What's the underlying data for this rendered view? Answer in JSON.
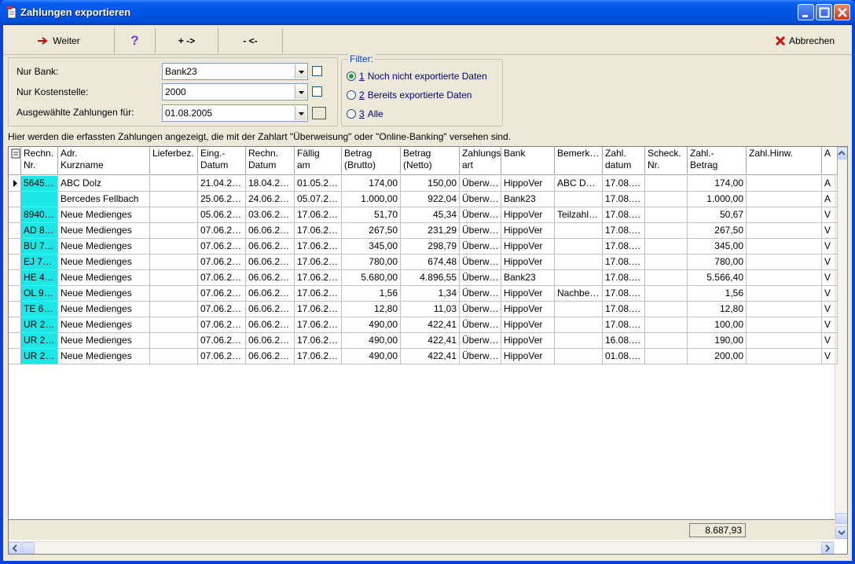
{
  "window": {
    "title": "Zahlungen exportieren"
  },
  "toolbar": {
    "weiter_label": "Weiter",
    "help_icon": "question-icon",
    "plus_label": "+ ->",
    "minus_label": "- <-",
    "abbrechen_label": "Abbrechen"
  },
  "filters": {
    "nur_bank_label": "Nur Bank:",
    "nur_bank_value": "Bank23",
    "kostenstelle_label": "Nur Kostenstelle:",
    "kostenstelle_value": "2000",
    "zahlungen_label": "Ausgewählte Zahlungen für:",
    "zahlungen_value": "01.08.2005"
  },
  "filter_group": {
    "legend": "Filter:",
    "options": [
      {
        "key": "1",
        "label": "Noch nicht exportierte Daten",
        "selected": true
      },
      {
        "key": "2",
        "label": "Bereits exportierte Daten",
        "selected": false
      },
      {
        "key": "3",
        "label": "Alle",
        "selected": false
      }
    ]
  },
  "info_text": "Hier werden die erfassten Zahlungen angezeigt, die mit der Zahlart \"Überweisung\" oder \"Online-Banking\" versehen sind.",
  "table": {
    "columns": [
      "Rechn.\nNr.",
      "Adr.\nKurzname",
      "Lieferbez.",
      "Eing.-\nDatum",
      "Rechn.\nDatum",
      "Fällig\nam",
      "Betrag\n(Brutto)",
      "Betrag\n(Netto)",
      "Zahlungs\nart",
      "Bank",
      "Bemerk…",
      "Zahl.\ndatum",
      "Scheck.\nNr.",
      "Zahl.-\nBetrag",
      "Zahl.Hinw.",
      "A"
    ],
    "rows": [
      [
        "5645…",
        "ABC Dolz",
        "",
        "21.04.2…",
        "18.04.2…",
        "01.05.2…",
        "174,00",
        "150,00",
        "Überw…",
        "HippoVer",
        "ABC D…",
        "17.08.…",
        "",
        "174,00",
        "",
        "A"
      ],
      [
        "",
        "Bercedes Fellbach",
        "",
        "25.06.2…",
        "24.06.2…",
        "05.07.2…",
        "1.000,00",
        "922,04",
        "Überw…",
        "Bank23",
        "",
        "17.08.…",
        "",
        "1.000,00",
        "",
        "A"
      ],
      [
        "8940…",
        "Neue Medienges",
        "",
        "05.06.2…",
        "03.06.2…",
        "17.06.2…",
        "51,70",
        "45,34",
        "Überw…",
        "HippoVer",
        "Teilzahl…",
        "17.08.…",
        "",
        "50,67",
        "",
        "V"
      ],
      [
        "AD 8…",
        "Neue Medienges",
        "",
        "07.06.2…",
        "06.06.2…",
        "17.06.2…",
        "267,50",
        "231,29",
        "Überw…",
        "HippoVer",
        "",
        "17.08.…",
        "",
        "267,50",
        "",
        "V"
      ],
      [
        "BU 7…",
        "Neue Medienges",
        "",
        "07.06.2…",
        "06.06.2…",
        "17.06.2…",
        "345,00",
        "298,79",
        "Überw…",
        "HippoVer",
        "",
        "17.08.…",
        "",
        "345,00",
        "",
        "V"
      ],
      [
        "EJ 7…",
        "Neue Medienges",
        "",
        "07.06.2…",
        "06.06.2…",
        "17.06.2…",
        "780,00",
        "674,48",
        "Überw…",
        "HippoVer",
        "",
        "17.08.…",
        "",
        "780,00",
        "",
        "V"
      ],
      [
        "HE 4…",
        "Neue Medienges",
        "",
        "07.06.2…",
        "06.06.2…",
        "17.06.2…",
        "5.680,00",
        "4.896,55",
        "Überw…",
        "Bank23",
        "",
        "17.08.…",
        "",
        "5.566,40",
        "",
        "V"
      ],
      [
        "OL 9…",
        "Neue Medienges",
        "",
        "07.06.2…",
        "06.06.2…",
        "17.06.2…",
        "1,56",
        "1,34",
        "Überw…",
        "HippoVer",
        "Nachbe…",
        "17.08.…",
        "",
        "1,56",
        "",
        "V"
      ],
      [
        "TE 6…",
        "Neue Medienges",
        "",
        "07.06.2…",
        "06.06.2…",
        "17.06.2…",
        "12,80",
        "11,03",
        "Überw…",
        "HippoVer",
        "",
        "17.08.…",
        "",
        "12,80",
        "",
        "V"
      ],
      [
        "UR 2…",
        "Neue Medienges",
        "",
        "07.06.2…",
        "06.06.2…",
        "17.06.2…",
        "490,00",
        "422,41",
        "Überw…",
        "HippoVer",
        "",
        "17.08.…",
        "",
        "100,00",
        "",
        "V"
      ],
      [
        "UR 2…",
        "Neue Medienges",
        "",
        "07.06.2…",
        "06.06.2…",
        "17.06.2…",
        "490,00",
        "422,41",
        "Überw…",
        "HippoVer",
        "",
        "16.08.…",
        "",
        "190,00",
        "",
        "V"
      ],
      [
        "UR 2…",
        "Neue Medienges",
        "",
        "07.06.2…",
        "06.06.2…",
        "17.06.2…",
        "490,00",
        "422,41",
        "Überw…",
        "HippoVer",
        "",
        "01.08.…",
        "",
        "200,00",
        "",
        "V"
      ]
    ],
    "numeric_columns": [
      6,
      7,
      13
    ],
    "current_row": 0,
    "total": "8.687,93"
  },
  "colors": {
    "highlight_cyan": "#1ce6e6",
    "title_blue": "#0054e3"
  }
}
